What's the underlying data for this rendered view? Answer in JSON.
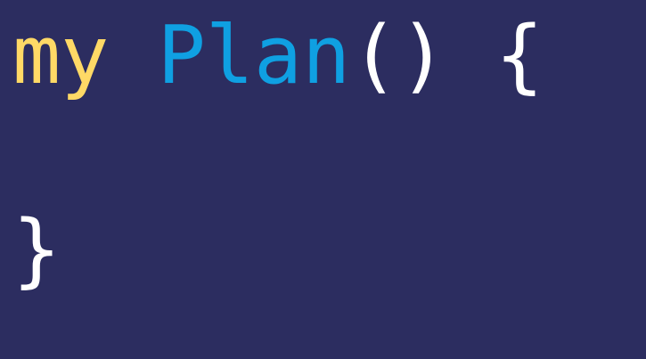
{
  "code": {
    "line1": {
      "keyword": "my",
      "space1": " ",
      "func": "Plan",
      "parens": "()",
      "space2": " ",
      "open_brace": "{"
    },
    "line3": {
      "close_brace": "}"
    }
  },
  "colors": {
    "background": "#2c2d60",
    "keyword": "#ffd966",
    "function": "#0fa0e2",
    "punctuation": "#ffffff"
  }
}
